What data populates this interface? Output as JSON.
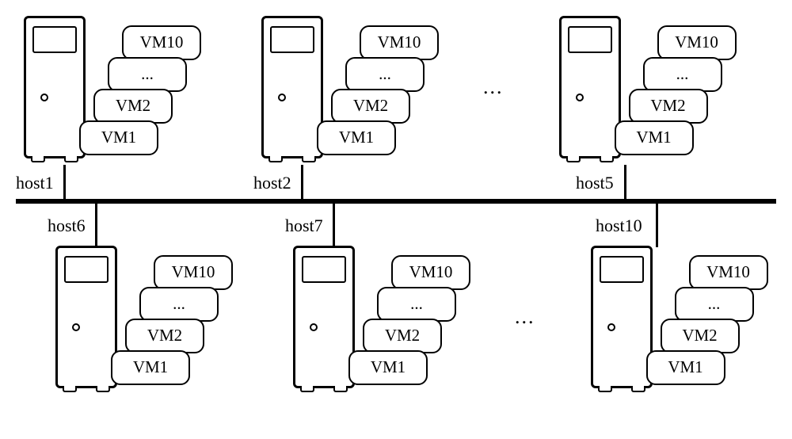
{
  "vm_labels": {
    "top": "VM10",
    "dots": "...",
    "mid": "VM2",
    "bottom": "VM1"
  },
  "hosts_top": [
    {
      "label": "host1"
    },
    {
      "label": "host2"
    },
    {
      "label": "host5"
    }
  ],
  "hosts_bottom": [
    {
      "label": "host6"
    },
    {
      "label": "host7"
    },
    {
      "label": "host10"
    }
  ],
  "ellipsis": "..."
}
